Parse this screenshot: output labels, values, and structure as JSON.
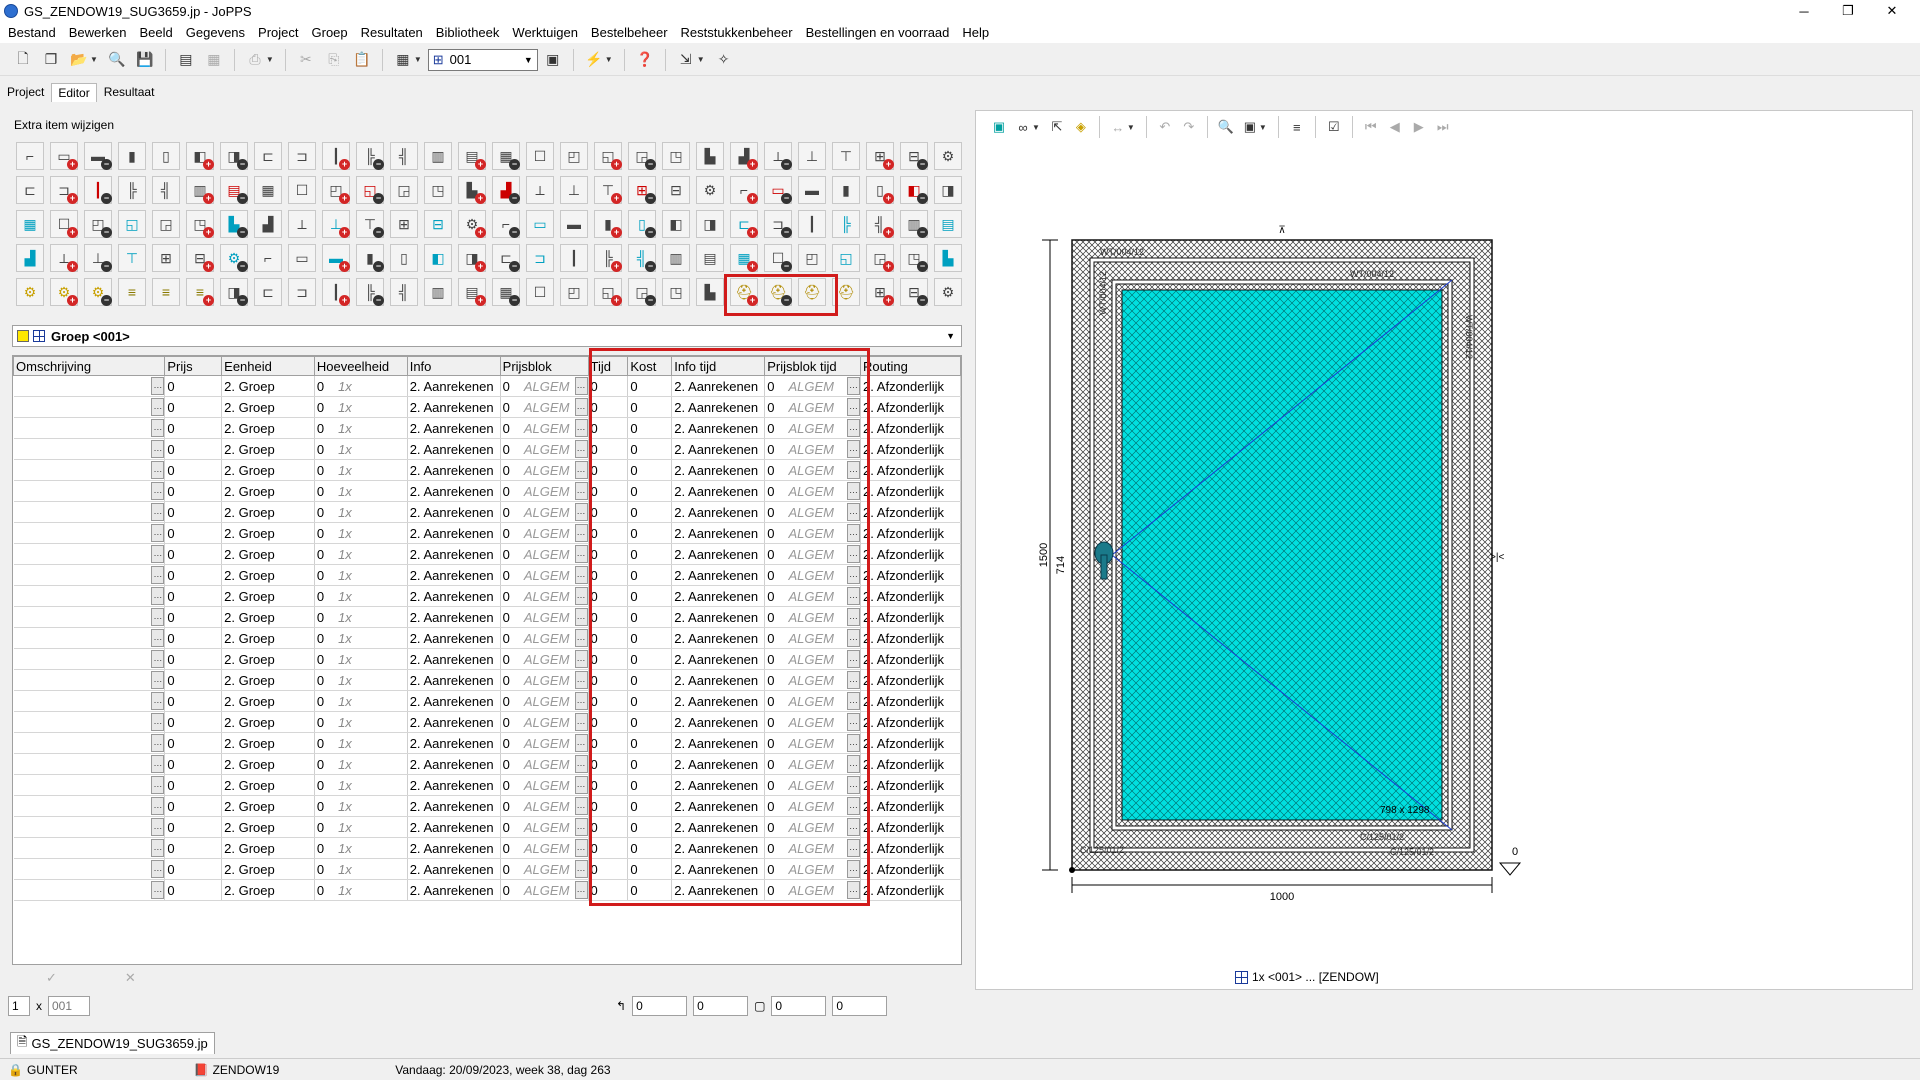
{
  "window": {
    "title": "GS_ZENDOW19_SUG3659.jp - JoPPS",
    "minimize": "─",
    "maximize": "❐",
    "close": "✕"
  },
  "menu": [
    "Bestand",
    "Bewerken",
    "Beeld",
    "Gegevens",
    "Project",
    "Groep",
    "Resultaten",
    "Bibliotheek",
    "Werktuigen",
    "Bestelbeheer",
    "Reststukkenbeheer",
    "Bestellingen en voorraad",
    "Help"
  ],
  "toolbar": {
    "group_combo": "001"
  },
  "tabs": [
    "Project",
    "Editor",
    "Resultaat"
  ],
  "palette": {
    "label": "Extra item wijzigen"
  },
  "group_selector": {
    "value": "Groep <001>"
  },
  "table": {
    "columns": [
      "Omschrijving",
      "Prijs",
      "Eenheid",
      "Hoeveelheid",
      "Info",
      "Prijsblok",
      "Tijd",
      "Kost",
      "Info tijd",
      "Prijsblok tijd",
      "Routing"
    ],
    "row": {
      "omschrijving": "",
      "prijs": "0",
      "eenheid": "2. Groep",
      "hoeveelheid": "0",
      "hoeveelheid_formula": "1x",
      "info": "2. Aanrekenen",
      "prijsblok_num": "0",
      "prijsblok": "ALGEM",
      "tijd": "0",
      "kost": "0",
      "info_tijd": "2. Aanrekenen",
      "prijsblok_tijd_num": "0",
      "prijsblok_tijd": "ALGEM",
      "routing": "2. Afzonderlijk"
    },
    "row_count": 25
  },
  "footer": {
    "qty": "1",
    "x": "x",
    "group": "001",
    "f1": "0",
    "f2": "0",
    "f3": "0",
    "f4": "0"
  },
  "drawing": {
    "dim_width": "1000",
    "dim_height": "1500",
    "dim_handle": "714",
    "dim_zero": "0",
    "glass_label": "798 x 1298",
    "profile_labels": [
      "WT/004/12",
      "WT/004/12",
      "WT/004/12",
      "WT/004/12",
      "C/125/01/2",
      "C/125/01/2",
      "C/125/01/2"
    ],
    "glass_color": "#00e0e0",
    "caption": "1x <001> ... [ZENDOW]"
  },
  "filetab": "GS_ZENDOW19_SUG3659.jp",
  "status": {
    "user": "GUNTER",
    "system": "ZENDOW19",
    "date": "Vandaag: 20/09/2023, week 38, dag 263"
  }
}
